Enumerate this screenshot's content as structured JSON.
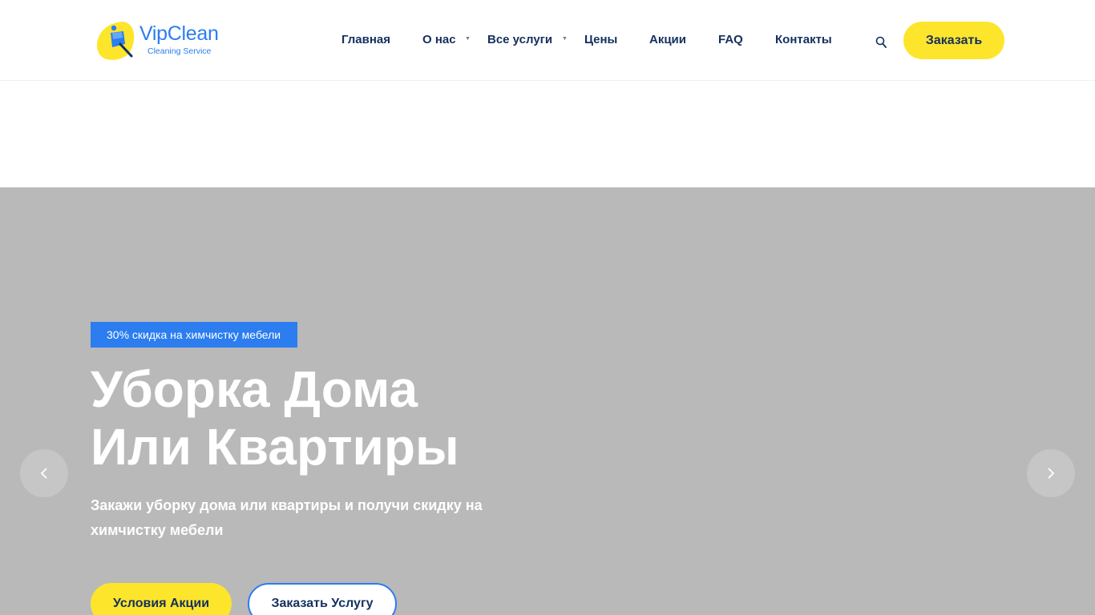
{
  "brand": {
    "name": "VipClean",
    "tagline": "Cleaning Service",
    "logo_icon": "mop-bucket-icon",
    "primary_color": "#2b7df0",
    "accent_color": "#fde52c",
    "text_color": "#14305e"
  },
  "nav": {
    "items": [
      {
        "label": "Главная",
        "has_dropdown": false
      },
      {
        "label": "О нас",
        "has_dropdown": true
      },
      {
        "label": "Все услуги",
        "has_dropdown": true
      },
      {
        "label": "Цены",
        "has_dropdown": false
      },
      {
        "label": "Акции",
        "has_dropdown": false
      },
      {
        "label": "FAQ",
        "has_dropdown": false
      },
      {
        "label": "Контакты",
        "has_dropdown": false
      }
    ],
    "search_icon": "search-icon",
    "order_label": "Заказать"
  },
  "hero": {
    "background_color": "#b9b9b9",
    "badge": "30% скидка на химчистку мебели",
    "title_line1": "Уборка Дома",
    "title_line2": "Или Квартиры",
    "subtitle": "Закажи уборку дома или квартиры и получи скидку на химчистку мебели",
    "cta_primary": "Условия Акции",
    "cta_secondary": "Заказать Услугу",
    "prev_icon": "chevron-left-icon",
    "next_icon": "chevron-right-icon"
  }
}
